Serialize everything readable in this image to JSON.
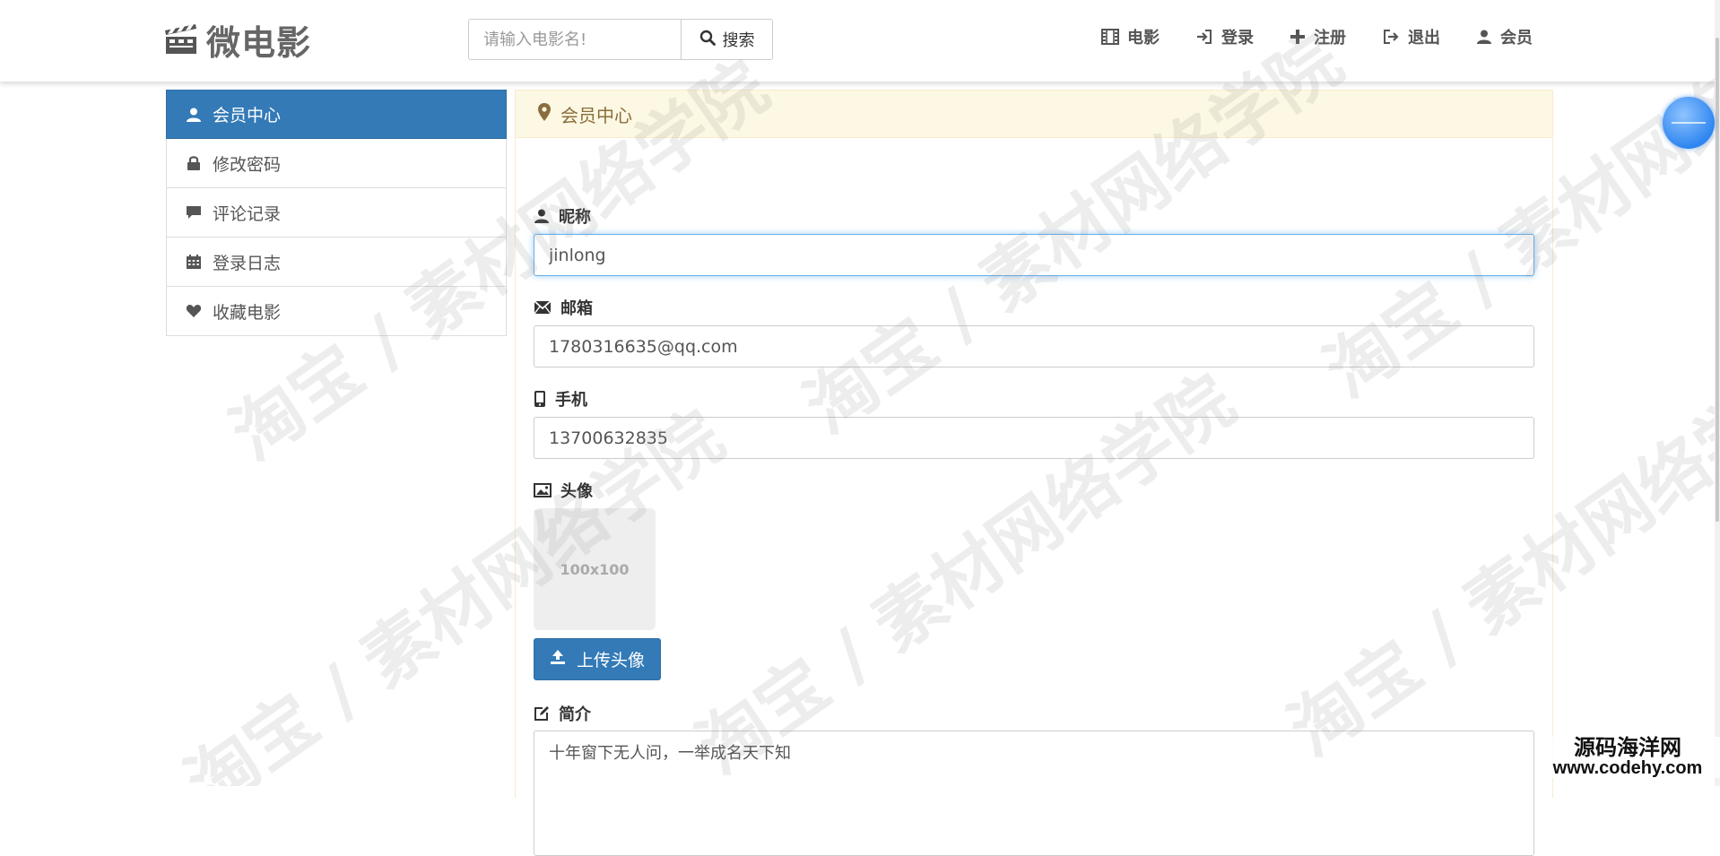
{
  "brand": {
    "name": "微电影"
  },
  "search": {
    "placeholder": "请输入电影名!",
    "button_label": "搜索"
  },
  "nav": {
    "items": [
      {
        "label": "电影",
        "icon": "film-icon"
      },
      {
        "label": "登录",
        "icon": "log-in-icon"
      },
      {
        "label": "注册",
        "icon": "plus-icon"
      },
      {
        "label": "退出",
        "icon": "log-out-icon"
      },
      {
        "label": "会员",
        "icon": "user-icon"
      }
    ]
  },
  "sidebar": {
    "items": [
      {
        "label": "会员中心",
        "icon": "user-icon",
        "active": true
      },
      {
        "label": "修改密码",
        "icon": "lock-icon",
        "active": false
      },
      {
        "label": "评论记录",
        "icon": "comment-icon",
        "active": false
      },
      {
        "label": "登录日志",
        "icon": "calendar-icon",
        "active": false
      },
      {
        "label": "收藏电影",
        "icon": "heart-icon",
        "active": false
      }
    ]
  },
  "panel": {
    "title": "会员中心",
    "fields": {
      "nickname": {
        "label": "昵称",
        "value": "jinlong"
      },
      "email": {
        "label": "邮箱",
        "value": "1780316635@qq.com"
      },
      "phone": {
        "label": "手机",
        "value": "13700632835"
      },
      "avatar": {
        "label": "头像",
        "placeholder_text": "100x100",
        "upload_label": "上传头像"
      },
      "bio": {
        "label": "简介",
        "value": "十年窗下无人问，一举成名天下知"
      }
    }
  },
  "watermark": {
    "text": "淘宝 / 素材网络学院"
  },
  "corner_brand": {
    "line1": "源码海洋网",
    "line2": "www.codehy.com"
  },
  "colors": {
    "primary": "#337ab7",
    "warning_bg": "#fcf8e3",
    "warning_text": "#8a6d3b",
    "focus_border": "#66afe9"
  }
}
